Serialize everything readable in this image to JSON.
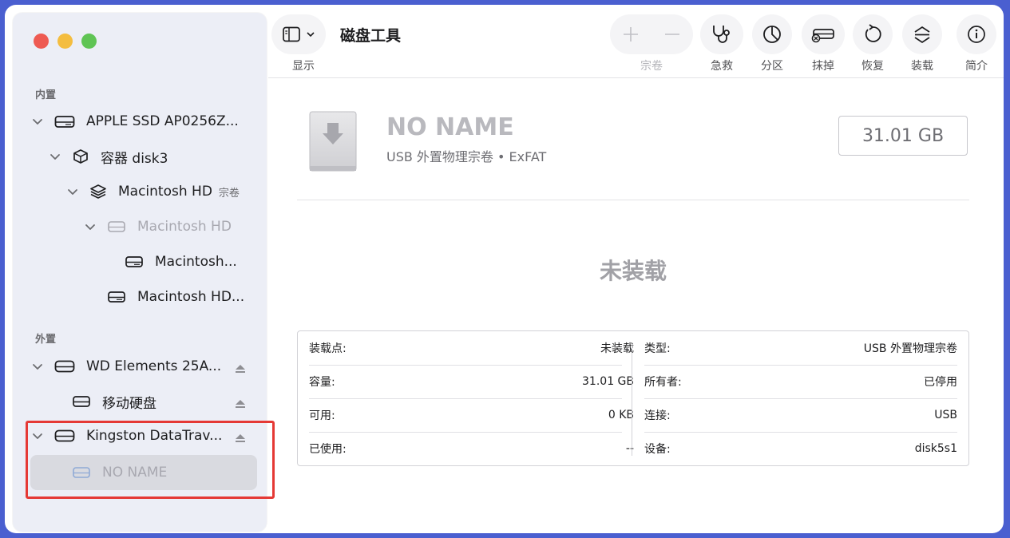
{
  "sidebar": {
    "sections": {
      "internal": "内置",
      "external": "外置"
    },
    "items": [
      {
        "label": "APPLE SSD AP0256Z...",
        "tag": ""
      },
      {
        "label": "容器 disk3",
        "tag": ""
      },
      {
        "label": "Macintosh HD",
        "tag": "宗卷"
      },
      {
        "label": "Macintosh HD",
        "tag": ""
      },
      {
        "label": "Macintosh...",
        "tag": ""
      },
      {
        "label": "Macintosh HD...",
        "tag": ""
      },
      {
        "label": "WD Elements 25A...",
        "tag": ""
      },
      {
        "label": "移动硬盘",
        "tag": ""
      },
      {
        "label": "Kingston DataTrav...",
        "tag": ""
      },
      {
        "label": "NO NAME",
        "tag": ""
      }
    ]
  },
  "toolbar": {
    "title": "磁盘工具",
    "view_label": "显示",
    "volume_label": "宗卷",
    "first_aid_label": "急救",
    "partition_label": "分区",
    "erase_label": "抹掉",
    "restore_label": "恢复",
    "mount_label": "装载",
    "info_label": "简介"
  },
  "main": {
    "disk_name": "NO NAME",
    "disk_subtitle": "USB 外置物理宗卷 • ExFAT",
    "capacity": "31.01 GB",
    "status": "未装载",
    "info_left": [
      {
        "key": "装载点:",
        "value": "未装载"
      },
      {
        "key": "容量:",
        "value": "31.01 GB"
      },
      {
        "key": "可用:",
        "value": "0 KB"
      },
      {
        "key": "已使用:",
        "value": "--"
      }
    ],
    "info_right": [
      {
        "key": "类型:",
        "value": "USB 外置物理宗卷"
      },
      {
        "key": "所有者:",
        "value": "已停用"
      },
      {
        "key": "连接:",
        "value": "USB"
      },
      {
        "key": "设备:",
        "value": "disk5s1"
      }
    ]
  },
  "colors": {
    "background": "#4a5fd0",
    "highlight": "#e53935",
    "selected_row": "#d9dae0"
  }
}
